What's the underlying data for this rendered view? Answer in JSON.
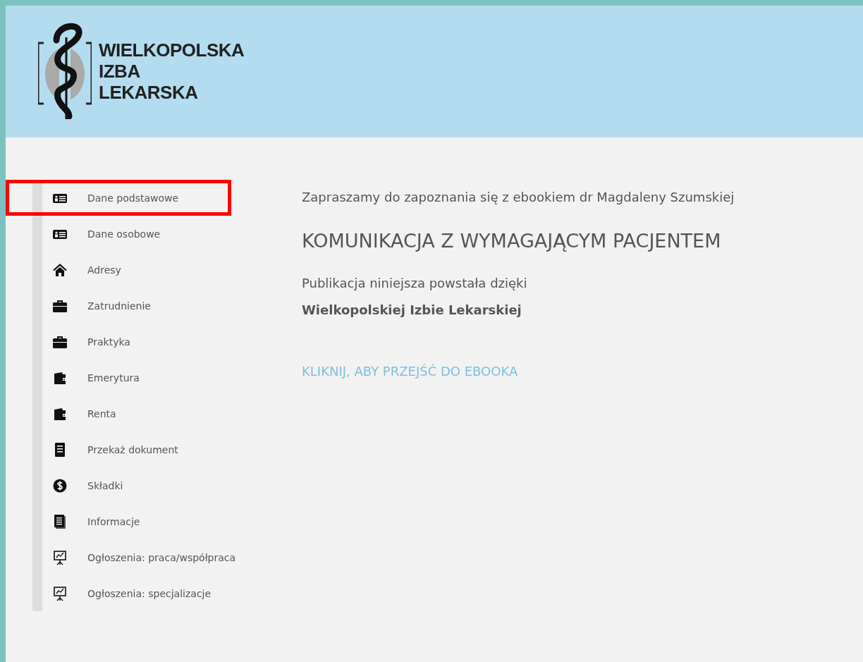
{
  "header": {
    "logo": {
      "lines": [
        "WIELKOPOLSKA",
        "IZBA",
        "LEKARSKA"
      ]
    }
  },
  "sidebar": {
    "items": [
      {
        "label": "Dane podstawowe",
        "kind": "idcard",
        "highlighted": true
      },
      {
        "label": "Dane osobowe",
        "kind": "idcard",
        "highlighted": false
      },
      {
        "label": "Adresy",
        "kind": "home",
        "highlighted": false
      },
      {
        "label": "Zatrudnienie",
        "kind": "briefcase",
        "highlighted": false
      },
      {
        "label": "Praktyka",
        "kind": "briefcase",
        "highlighted": false
      },
      {
        "label": "Emerytura",
        "kind": "wallet",
        "highlighted": false
      },
      {
        "label": "Renta",
        "kind": "wallet",
        "highlighted": false
      },
      {
        "label": "Przekaż dokument",
        "kind": "document",
        "highlighted": false
      },
      {
        "label": "Składki",
        "kind": "dollar",
        "highlighted": false
      },
      {
        "label": "Informacje",
        "kind": "documents",
        "highlighted": false
      },
      {
        "label": "Ogłoszenia: praca/współpraca",
        "kind": "presentation",
        "highlighted": false
      },
      {
        "label": "Ogłoszenia: specjalizacje",
        "kind": "presentation",
        "highlighted": false
      }
    ]
  },
  "content": {
    "intro": "Zapraszamy do zapoznania się z ebookiem dr Magdaleny Szumskiej",
    "title": "KOMUNIKACJA Z WYMAGAJĄCYM PACJENTEM",
    "note": "Publikacja niniejsza powstała dzięki",
    "sponsor": "Wielkopolskiej Izbie Lekarskiej",
    "link": "KLIKNIJ, ABY PRZEJŚĆ DO EBOOKA"
  }
}
